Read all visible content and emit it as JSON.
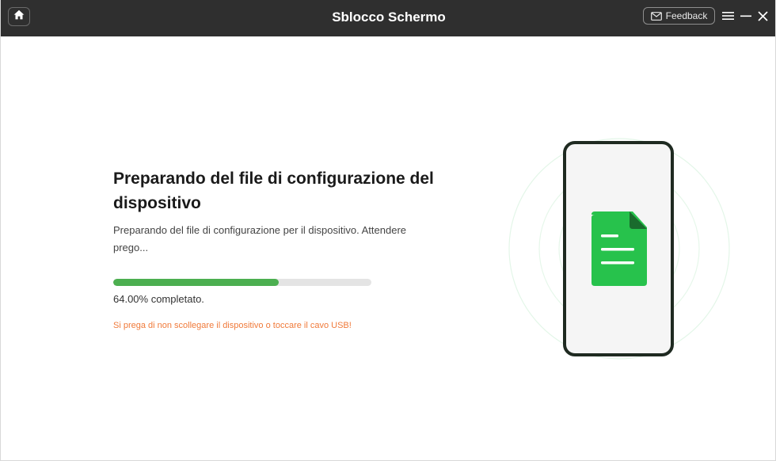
{
  "titlebar": {
    "title": "Sblocco Schermo",
    "feedback_label": "Feedback",
    "icons": {
      "home": "home-icon",
      "feedback": "mail-icon",
      "menu": "hamburger-menu-icon",
      "minimize": "minimize-icon",
      "close": "close-icon"
    }
  },
  "main": {
    "heading": "Preparando del file di configurazione del dispositivo",
    "description": "Preparando del file di configurazione per il dispositivo. Attendere prego...",
    "progress_percent": 64,
    "progress_text": "64.00% completato.",
    "warning": "Si prega di non scollegare il dispositivo o toccare il cavo USB!"
  },
  "colors": {
    "titlebar_bg": "#2f2f2f",
    "progress_fill": "#4caf50",
    "progress_track": "#e4e4e4",
    "warning": "#f07a3a",
    "document_green": "#27c24c"
  },
  "illustration": {
    "device": "phone-icon",
    "content": "document-file-icon"
  }
}
